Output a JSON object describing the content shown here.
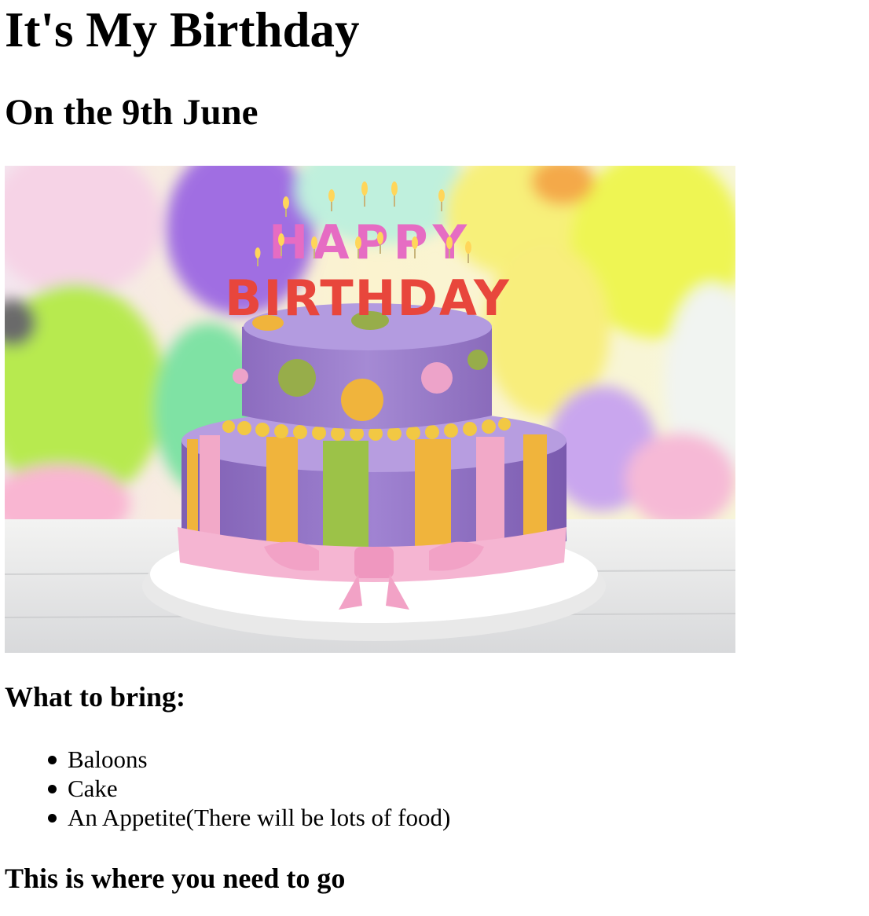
{
  "page": {
    "title": "It's My Birthday",
    "subtitle": "On the 9th June"
  },
  "photo": {
    "candles_top": "HAPPY",
    "candles_bottom": "BIRTHDAY"
  },
  "bring": {
    "heading": "What to bring:",
    "items": [
      {
        "label": "Baloons"
      },
      {
        "label": "Cake"
      },
      {
        "label": "An Appetite(There will be lots of food)"
      }
    ]
  },
  "directions": {
    "heading": "This is where you need to go"
  },
  "colors": {
    "text": "#000000",
    "background": "#ffffff",
    "cake_purple": "#9a78c9",
    "cake_pink": "#f2a9c8",
    "cake_yellow": "#f0b43c",
    "cake_green": "#9cc248"
  }
}
